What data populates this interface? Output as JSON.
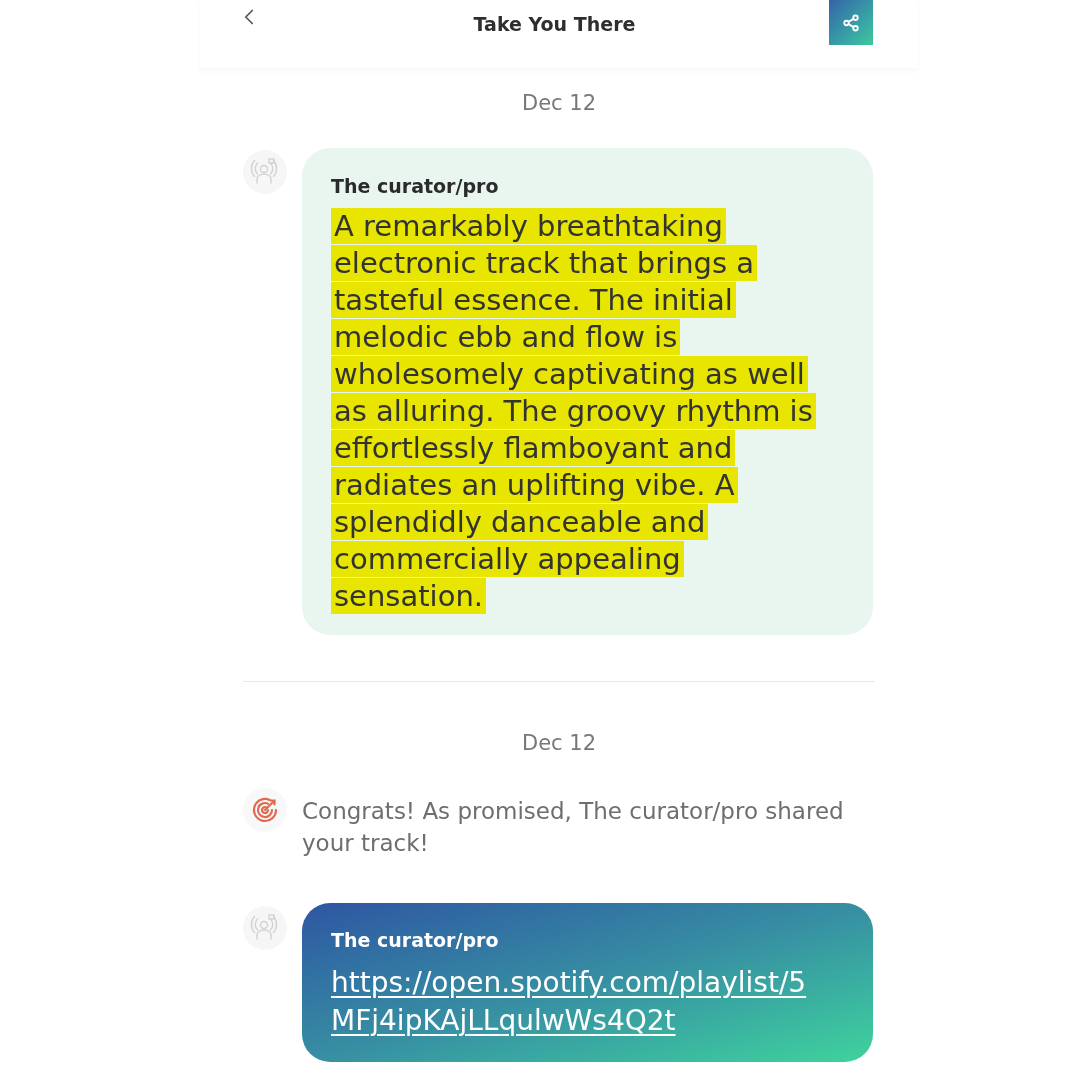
{
  "header": {
    "title": "Take You There"
  },
  "sections": [
    {
      "date": "Dec 12",
      "items": [
        {
          "kind": "message",
          "sender": "The curator/pro",
          "text_lines": [
            "A remarkably breathtaking",
            "electronic track that brings a",
            "tasteful essence. The initial",
            "melodic ebb and flow is",
            "wholesomely captivating as well",
            "as alluring. The groovy rhythm is",
            "effortlessly flamboyant and",
            "radiates an uplifting vibe. A",
            "splendidly danceable and",
            "commercially appealing",
            "sensation."
          ],
          "highlighted": true
        }
      ]
    },
    {
      "date": "Dec 12",
      "items": [
        {
          "kind": "notice",
          "text": "Congrats! As promised, The curator/pro shared your track!"
        },
        {
          "kind": "link_message",
          "sender": "The curator/pro",
          "link": "https://open.spotify.com/playlist/5MFj4ipKAjLLqulwWs4Q2t"
        }
      ]
    }
  ]
}
